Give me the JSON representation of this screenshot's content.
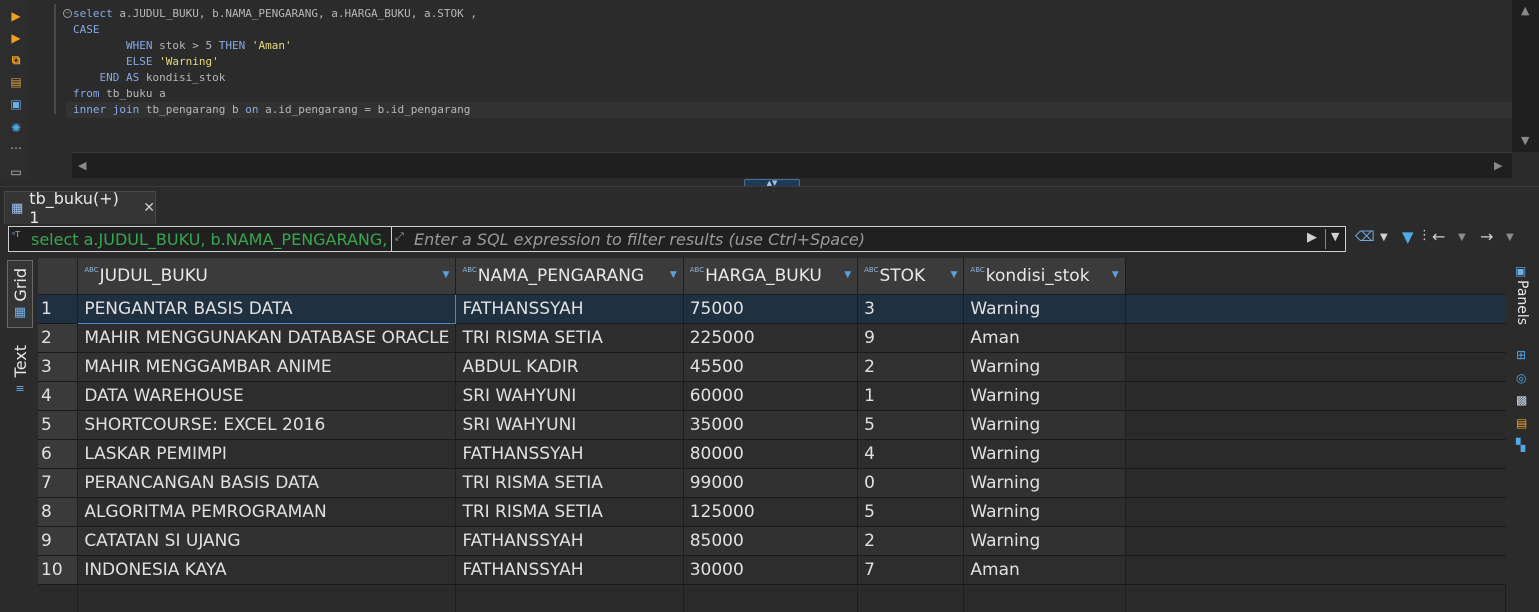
{
  "editor": {
    "sql_lines": [
      [
        {
          "t": "kw",
          "v": "select "
        },
        {
          "t": "idn",
          "v": "a.JUDUL_BUKU, b.NAMA_PENGARANG, a.HARGA_BUKU, a.STOK ,"
        }
      ],
      [
        {
          "t": "kw",
          "v": "CASE"
        }
      ],
      [
        {
          "t": "idn",
          "v": "        "
        },
        {
          "t": "kw",
          "v": "WHEN "
        },
        {
          "t": "idn",
          "v": "stok > 5 "
        },
        {
          "t": "kw",
          "v": "THEN "
        },
        {
          "t": "str",
          "v": "'Aman'"
        }
      ],
      [
        {
          "t": "idn",
          "v": "        "
        },
        {
          "t": "kw",
          "v": "ELSE "
        },
        {
          "t": "str",
          "v": "'Warning'"
        }
      ],
      [
        {
          "t": "idn",
          "v": "    "
        },
        {
          "t": "kw",
          "v": "END AS "
        },
        {
          "t": "idn",
          "v": "kondisi_stok"
        }
      ],
      [
        {
          "t": "kw",
          "v": "from "
        },
        {
          "t": "idn",
          "v": "tb_buku a"
        }
      ],
      [
        {
          "t": "kw",
          "v": "inner join "
        },
        {
          "t": "idn",
          "v": "tb_pengarang b "
        },
        {
          "t": "kw",
          "v": "on "
        },
        {
          "t": "idn",
          "v": "a.id_pengarang = b.id_pengarang"
        }
      ]
    ]
  },
  "results": {
    "tab_label": "tb_buku(+) 1",
    "filter_history": "select a.JUDUL_BUKU, b.NAMA_PENGARANG, a.HARGA_BUKU, a.STOK, CASE WHEN stok > 5 THEN 'Aman' ELSE 'Warning' END AS kondisi_stok from tb_buku a inner join tb_pengarang b on a.id_pengarang = b.id_pengarang",
    "filter_placeholder": "Enter a SQL expression to filter results (use Ctrl+Space)",
    "side_tabs": {
      "grid": "Grid",
      "text": "Text"
    },
    "panels_label": "Panels",
    "type_badge": "ABC",
    "columns": [
      {
        "name": "JUDUL_BUKU",
        "width": 368
      },
      {
        "name": "NAMA_PENGARANG",
        "width": 228
      },
      {
        "name": "HARGA_BUKU",
        "width": 175
      },
      {
        "name": "STOK",
        "width": 107
      },
      {
        "name": "kondisi_stok",
        "width": 162
      }
    ],
    "rows": [
      [
        "1",
        "PENGANTAR BASIS DATA",
        "FATHANSSYAH",
        "75000",
        "3",
        "Warning"
      ],
      [
        "2",
        "MAHIR MENGGUNAKAN DATABASE ORACLE",
        "TRI RISMA SETIA",
        "225000",
        "9",
        "Aman"
      ],
      [
        "3",
        "MAHIR MENGGAMBAR ANIME",
        "ABDUL KADIR",
        "45500",
        "2",
        "Warning"
      ],
      [
        "4",
        "DATA WAREHOUSE",
        "SRI WAHYUNI",
        "60000",
        "1",
        "Warning"
      ],
      [
        "5",
        "SHORTCOURSE: EXCEL 2016",
        "SRI WAHYUNI",
        "35000",
        "5",
        "Warning"
      ],
      [
        "6",
        "LASKAR PEMIMPI",
        "FATHANSSYAH",
        "80000",
        "4",
        "Warning"
      ],
      [
        "7",
        "PERANCANGAN BASIS DATA",
        "TRI RISMA SETIA",
        "99000",
        "0",
        "Warning"
      ],
      [
        "8",
        "ALGORITMA PEMROGRAMAN",
        "TRI RISMA SETIA",
        "125000",
        "5",
        "Warning"
      ],
      [
        "9",
        "CATATAN SI UJANG",
        "FATHANSSYAH",
        "85000",
        "2",
        "Warning"
      ],
      [
        "10",
        "INDONESIA KAYA",
        "FATHANSSYAH",
        "30000",
        "7",
        "Aman"
      ]
    ]
  },
  "colors": {
    "keyword": "#86a9e6",
    "string": "#e6db74",
    "history_text": "#35a84f",
    "selection": "#4d87c7"
  }
}
